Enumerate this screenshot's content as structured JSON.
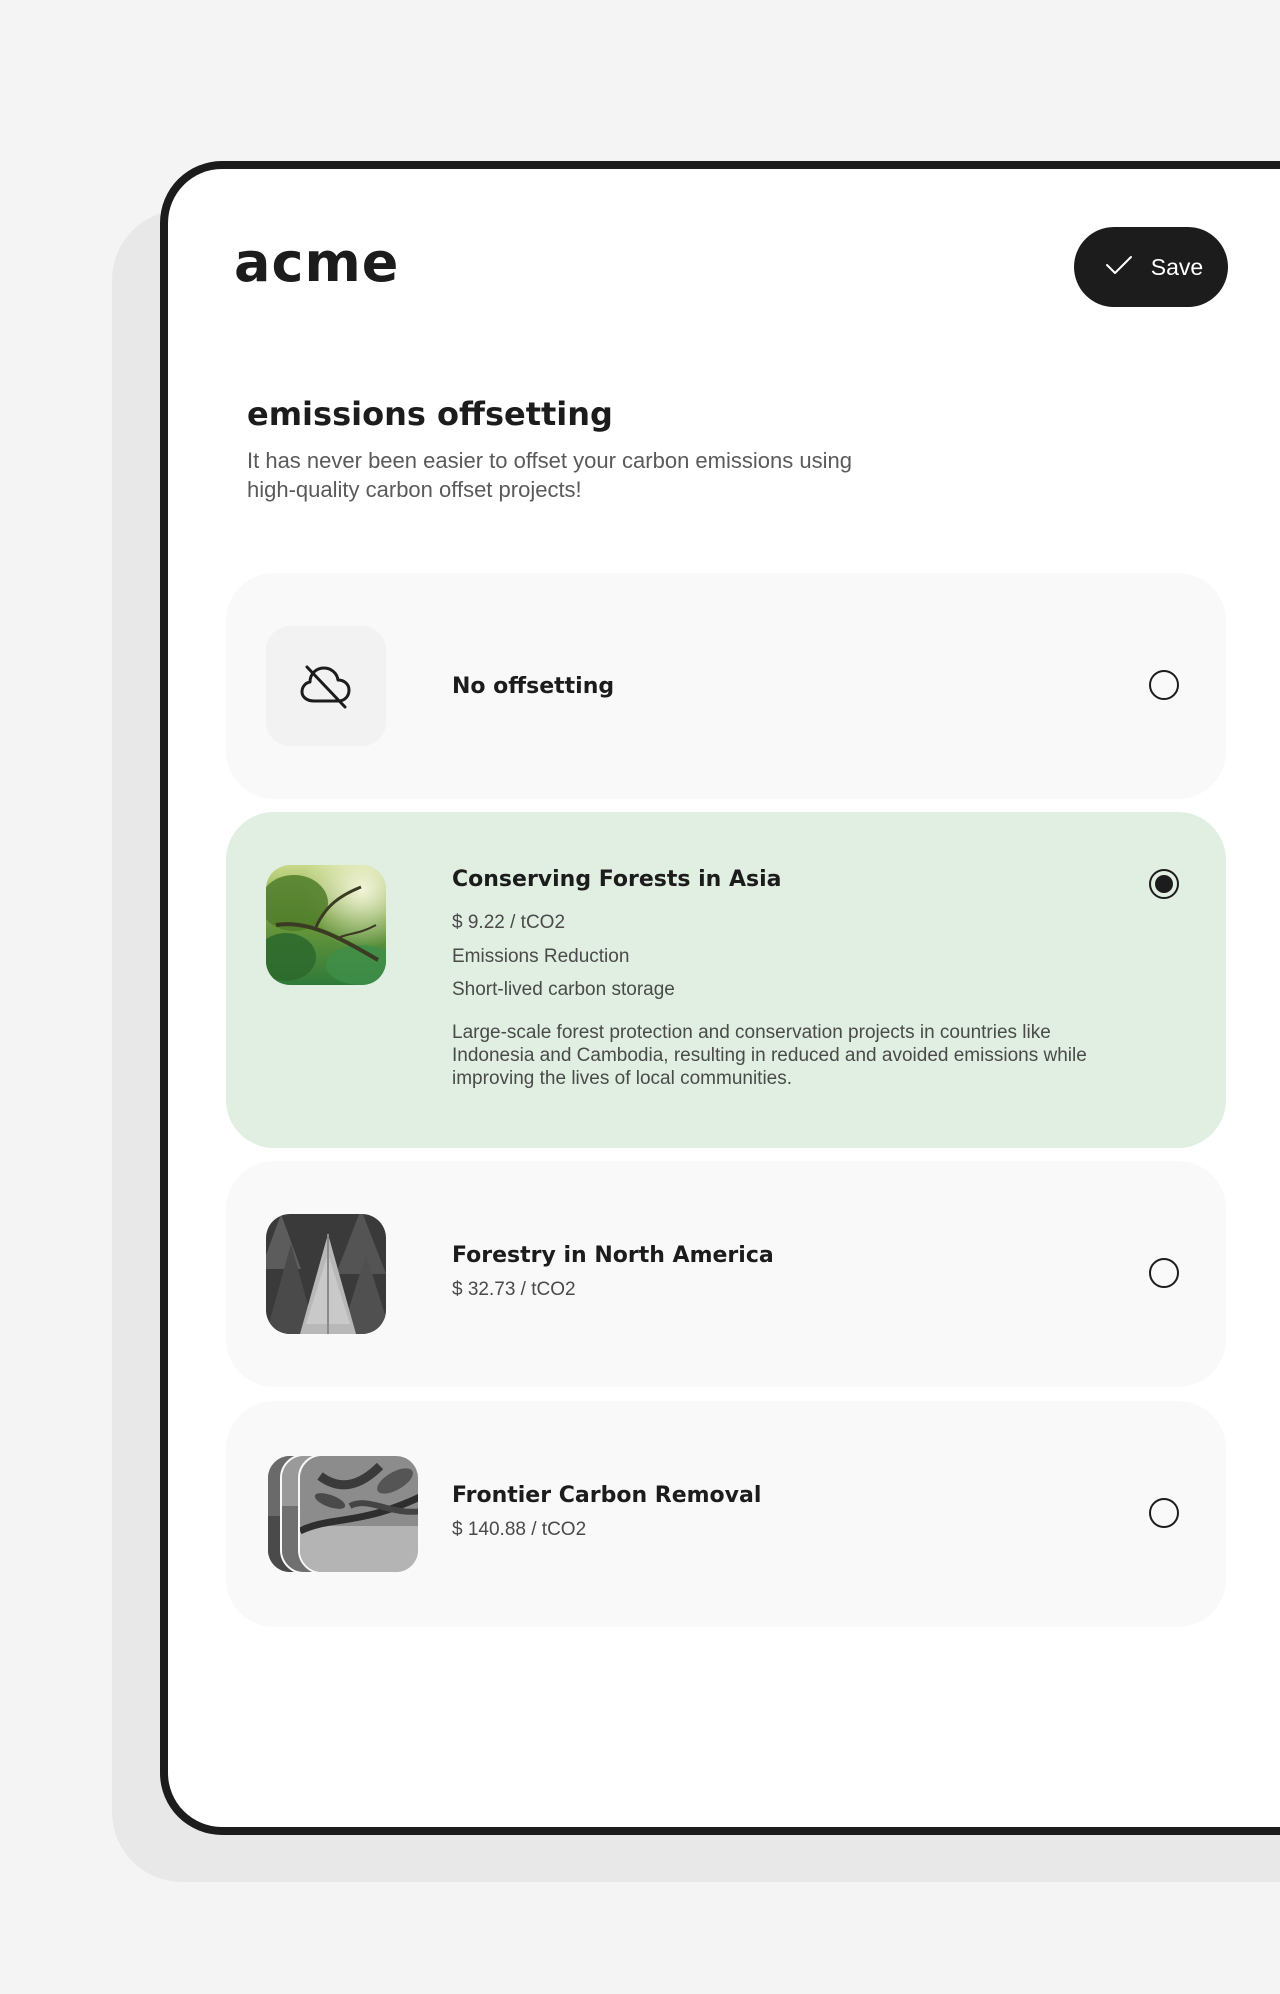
{
  "brand": {
    "logo_text": "acme"
  },
  "toolbar": {
    "save_label": "Save"
  },
  "page": {
    "title": "emissions offsetting",
    "subtitle": "It has never been easier to offset your carbon emissions using high-quality carbon offset projects!"
  },
  "options": [
    {
      "title": "No offsetting",
      "icon": "cloud-off-icon",
      "selected": false
    },
    {
      "title": "Conserving Forests in Asia",
      "price": "$ 9.22 / tCO2",
      "tag1": "Emissions Reduction",
      "tag2": "Short-lived carbon storage",
      "description": "Large-scale forest protection and conservation projects in countries like Indonesia and Cambodia, resulting in reduced and avoided emissions while improving the lives of local communities.",
      "selected": true
    },
    {
      "title": "Forestry in North America",
      "price": "$ 32.73 / tCO2",
      "selected": false
    },
    {
      "title": "Frontier Carbon Removal",
      "price": "$ 140.88 / tCO2",
      "selected": false
    }
  ],
  "colors": {
    "dark": "#1c1c1c",
    "selected_card": "#e0efe2",
    "card": "#f9f9f9",
    "page_bg": "#f4f4f4"
  }
}
